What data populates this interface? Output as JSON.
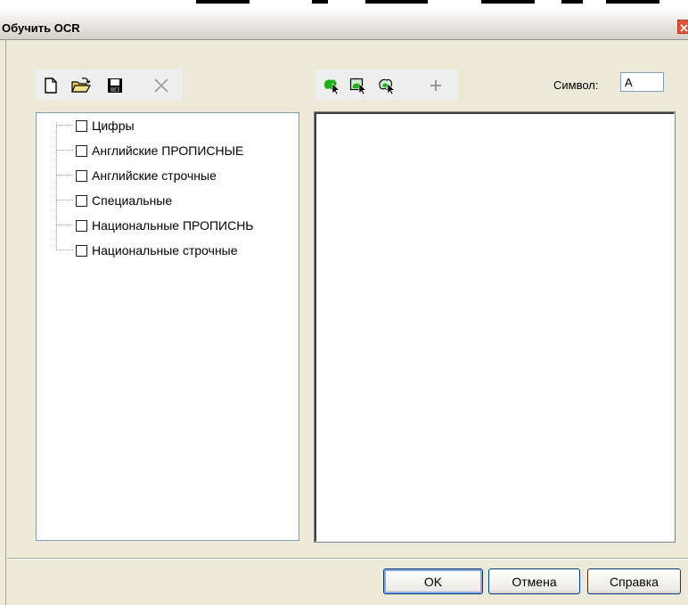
{
  "window": {
    "title": "Обучить OCR"
  },
  "file_toolbar": {
    "icons": [
      "new-file-icon",
      "open-folder-icon",
      "save-icon",
      "delete-icon"
    ]
  },
  "edit_toolbar": {
    "icons": [
      "select-green-icon",
      "select-frame-icon",
      "select-shape-icon",
      "add-icon"
    ]
  },
  "symbol": {
    "label": "Символ:",
    "value": "A"
  },
  "tree": {
    "items": [
      {
        "label": "Цифры",
        "checked": false
      },
      {
        "label": "Английские ПРОПИСНЫЕ",
        "checked": false
      },
      {
        "label": "Английские строчные",
        "checked": false
      },
      {
        "label": "Специальные",
        "checked": false
      },
      {
        "label": "Национальные ПРОПИСНЬ",
        "checked": false
      },
      {
        "label": "Национальные строчные",
        "checked": false
      }
    ]
  },
  "buttons": {
    "ok": "OK",
    "cancel": "Отмена",
    "help": "Справка"
  },
  "colors": {
    "dialog_bg": "#ece9d8",
    "border": "#7f9db9",
    "accent_green": "#1db01d",
    "close_red": "#e0553a"
  }
}
